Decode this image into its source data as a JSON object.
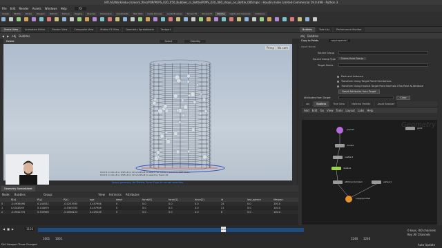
{
  "window": {
    "title": "/ATLAS/Work/edu-cls/work_files/POP/POPS_020_050_Bubbles_in_Bottle/POPS_020_060_drops_on_Bottle_006.hiplc - Houdini Indie Limited-Commercial 19.0.498 - Python 3"
  },
  "menu": [
    "File",
    "Edit",
    "Render",
    "Assets",
    "Windows",
    "Help"
  ],
  "desktop": "FX",
  "shelf_tabs": [
    "Create",
    "Modify",
    "Model",
    "Polygon",
    "Deform",
    "Texture",
    "Rigging",
    "Muscles",
    "Characters",
    "Constraints",
    "Hair Utils",
    "Guide Process",
    "Guide Brushes",
    "Terrain FX",
    "Simple FX",
    "Volume",
    "Lights and Cameras",
    "Collisions",
    "Particles",
    "Grains",
    "Vellum",
    "Rigid Bodies",
    "Particle Fluids",
    "Viscous Fluids",
    "Oceans",
    "Pyro FX",
    "FEM",
    "Wires",
    "Crowds",
    "Drive Simulation"
  ],
  "scene_tabs": [
    "Scene View",
    "Animation Editor",
    "Render View",
    "Composite View",
    "Motion FX View",
    "Geometry Spreadsheet",
    "Textport"
  ],
  "path": {
    "obj": "obj",
    "node": "Bubbles"
  },
  "viewport": {
    "tool": "Delete",
    "selectors": [
      "Select",
      "Visibility"
    ],
    "persp_label": "Persp",
    "cam_label": "No cam",
    "hint_line1": "Hold B or Ctrl+B or Shift+B or Ctrl+Shift+B to select Full SNNN or points to SOP Mode",
    "hint_line2": "Hold B or Ctrl+B or Shift+B or Ctrl+Shift+B to select by fluent Alt",
    "status": "Select geometry for Delete. Press Enter to accept selection."
  },
  "spreadsheet": {
    "tab": "Geometry Spreadsheet",
    "node_label": "Node:",
    "node_value": "Bubbles",
    "group_label": "Group:",
    "view_label": "View",
    "intrinsics_label": "Intrinsics",
    "attributes_label": "Attributes",
    "columns": [
      "",
      "P[x]",
      "P[y]",
      "P[z]",
      "age",
      "dead",
      "force[0]",
      "force[1]",
      "force[2]",
      "id",
      "last_apiece",
      "lifespan"
    ],
    "rows": [
      [
        "0",
        "-0.0938090",
        "0.244552",
        "-0.0233935",
        "0.457906",
        "0",
        "0.0",
        "0.0",
        "0.0",
        "24",
        "0.0",
        "100.0"
      ],
      [
        "1",
        "0.0418095",
        "0.130679",
        "-0.0309335",
        "0.457906",
        "0",
        "0.0",
        "0.0",
        "0.0",
        "21",
        "0.0",
        "100.0"
      ],
      [
        "2",
        "-0.0941375",
        "0.335966",
        "-0.0056123",
        "0.419248",
        "0",
        "0.0",
        "0.0",
        "0.0",
        "8",
        "0.0",
        "100.0"
      ]
    ]
  },
  "timeline": {
    "frame": "1123",
    "start": "1001",
    "start2": "1001",
    "end": "1240",
    "end2": "1240",
    "current_marker": "1123",
    "status_left": "DLV Viewport Times Changed",
    "keys_label": "0 keys, 0/0 channels",
    "key_all": "Key All Channels",
    "auto_update": "Auto Update"
  },
  "params": {
    "tabs": [
      "Bubbles",
      "Take List",
      "Performance Monitor"
    ],
    "path_obj": "obj",
    "path_node": "Bubbles",
    "op_type": "Copy to Points",
    "op_name": "copytopoints1",
    "asset_name_label": "Asset Name",
    "source_group_label": "Source Group",
    "source_group_type_label": "Source Group Type",
    "source_group_type_value": "Guess from Group",
    "target_points_label": "Target Points",
    "pack_instance_label": "Pack and Instance",
    "transform_label": "Transform Using Target Point Orientations",
    "transform_label2": "Transform Using Implicit Target Point Normals if No Point N Attribute",
    "reset_button": "Reset Attributes from Target",
    "attributes_from_target": "Attributes from Target",
    "clear_button": "Clear"
  },
  "network": {
    "tabs": [
      "obj",
      "Bubbles",
      "Tree View",
      "Material Palette",
      "Asset Browser"
    ],
    "menu": [
      "Add",
      "Edit",
      "Go",
      "View",
      "Tools",
      "Layout",
      "Labs",
      "Help"
    ],
    "watermark": "Geometry",
    "nodes": [
      {
        "label": "popnet",
        "color": "#b86ad8"
      },
      {
        "label": "grid1",
        "color": "#9a9a9a"
      },
      {
        "label": "mode1",
        "color": "#9a9a9a"
      },
      {
        "label": "scatter1",
        "color": "#9a9a9a"
      },
      {
        "label": "delete1",
        "color": "#9ad24d"
      },
      {
        "label": "attribrandomize1",
        "color": "#9a9a9a"
      },
      {
        "label": "sphere1",
        "color": "#9a9a9a"
      },
      {
        "label": "copytopoints1",
        "color": "#e8912c"
      }
    ]
  }
}
